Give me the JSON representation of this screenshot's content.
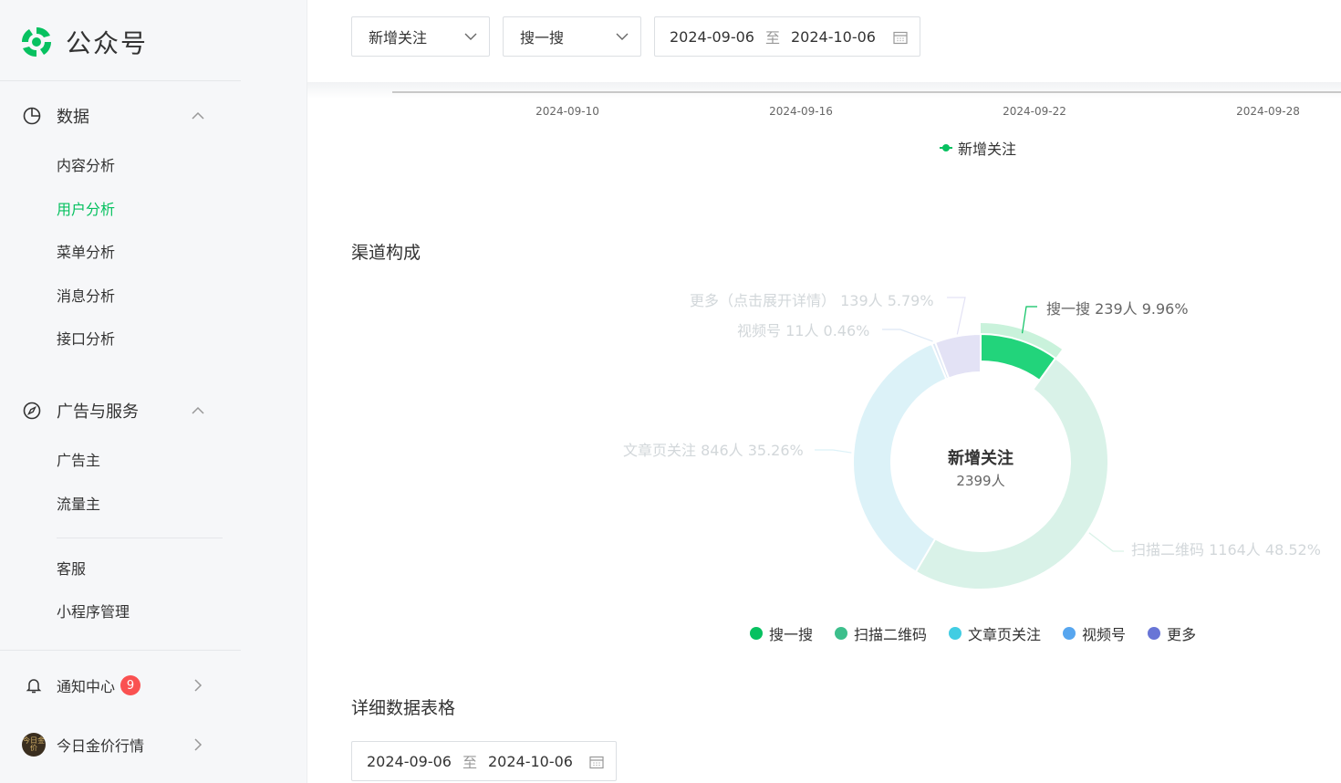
{
  "brand": {
    "name": "公众号"
  },
  "sidebar": {
    "groups": [
      {
        "label": "数据",
        "icon": "pie-chart-icon",
        "items": [
          "内容分析",
          "用户分析",
          "菜单分析",
          "消息分析",
          "接口分析"
        ],
        "active": "用户分析"
      },
      {
        "label": "广告与服务",
        "icon": "compass-icon",
        "items": [
          "广告主",
          "流量主",
          "客服",
          "小程序管理"
        ]
      }
    ],
    "bottom": {
      "notify_label": "通知中心",
      "notify_badge": "9",
      "account_label": "今日金价行情",
      "account_avatar_text": "今日金价"
    }
  },
  "filters": {
    "metric": "新增关注",
    "channel": "搜一搜",
    "date_start": "2024-09-06",
    "date_sep": "至",
    "date_end": "2024-10-06"
  },
  "trend_chart": {
    "x_ticks": [
      "2024-09-10",
      "2024-09-16",
      "2024-09-22",
      "2024-09-28"
    ],
    "legend": "新增关注"
  },
  "channel_section": {
    "title": "渠道构成"
  },
  "chart_data": {
    "type": "pie",
    "title": "新增关注",
    "total": "2399人",
    "slices": [
      {
        "name": "搜一搜",
        "count": 239,
        "percent": 9.96,
        "label": "搜一搜 239人 9.96%",
        "color": "#22d47b",
        "highlighted": true
      },
      {
        "name": "扫描二维码",
        "count": 1164,
        "percent": 48.52,
        "label": "扫描二维码 1164人 48.52%",
        "color": "#d9f2e8"
      },
      {
        "name": "文章页关注",
        "count": 846,
        "percent": 35.26,
        "label": "文章页关注 846人 35.26%",
        "color": "#dcf2f8"
      },
      {
        "name": "视频号",
        "count": 11,
        "percent": 0.46,
        "label": "视频号 11人 0.46%",
        "color": "#dde8f5"
      },
      {
        "name": "更多（点击展开详情）",
        "count": 139,
        "percent": 5.79,
        "label": "更多（点击展开详情） 139人 5.79%",
        "color": "#e3e2f5"
      }
    ],
    "legend": [
      {
        "name": "搜一搜",
        "color": "#07c160"
      },
      {
        "name": "扫描二维码",
        "color": "#3dbf8c"
      },
      {
        "name": "文章页关注",
        "color": "#41cde3"
      },
      {
        "name": "视频号",
        "color": "#57a6ef"
      },
      {
        "name": "更多",
        "color": "#6875d6"
      }
    ]
  },
  "detail_section": {
    "title": "详细数据表格",
    "date_start": "2024-09-06",
    "date_sep": "至",
    "date_end": "2024-10-06"
  }
}
